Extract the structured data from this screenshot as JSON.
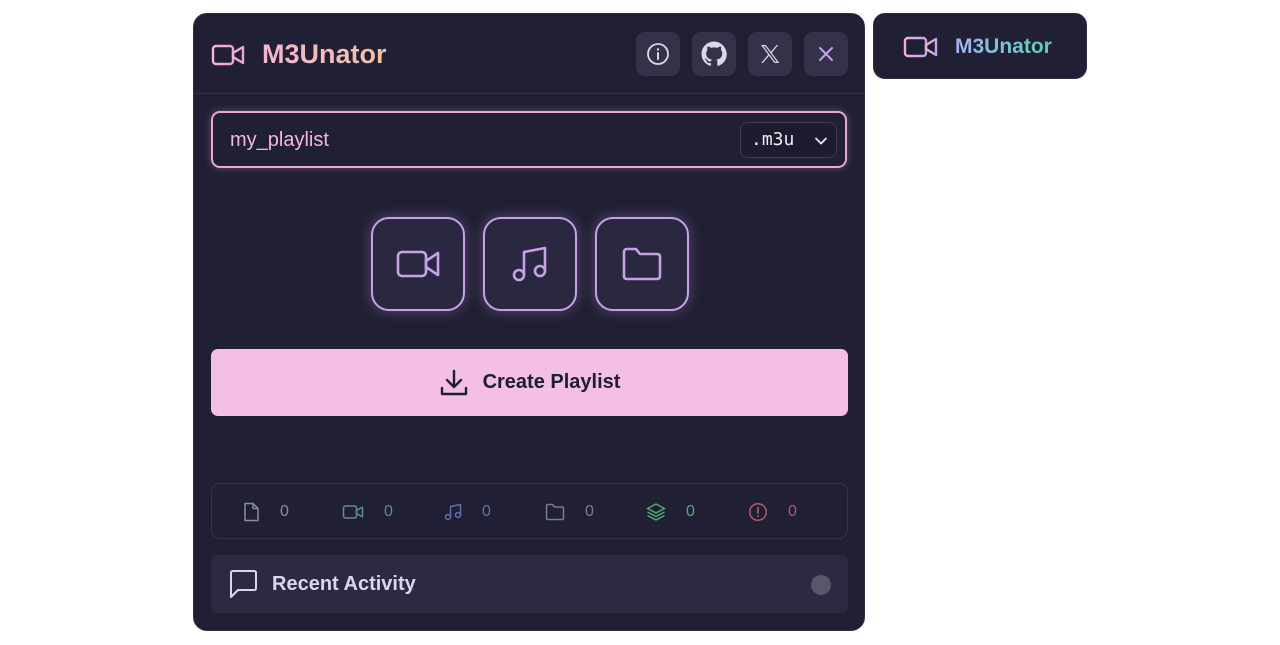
{
  "app": {
    "title": "M3Unator",
    "logo_icon": "video-camera-icon"
  },
  "header": {
    "buttons": [
      {
        "name": "info-button",
        "icon": "info-icon"
      },
      {
        "name": "github-button",
        "icon": "github-icon"
      },
      {
        "name": "x-twitter-button",
        "icon": "x-logo-icon"
      },
      {
        "name": "close-button",
        "icon": "close-icon"
      }
    ]
  },
  "playlist": {
    "name_value": "my_playlist",
    "extension": ".m3u"
  },
  "type_buttons": [
    {
      "name": "video-type-button",
      "icon": "video-camera-icon"
    },
    {
      "name": "audio-type-button",
      "icon": "music-note-icon"
    },
    {
      "name": "folder-type-button",
      "icon": "folder-icon"
    }
  ],
  "create_button": {
    "label": "Create Playlist",
    "icon": "download-icon"
  },
  "stats": [
    {
      "icon": "file-icon",
      "value": "0",
      "color": "#8a8aa6"
    },
    {
      "icon": "video-icon",
      "value": "0",
      "color": "#5c8f86"
    },
    {
      "icon": "music-icon",
      "value": "0",
      "color": "#5f73a8"
    },
    {
      "icon": "folder-icon",
      "value": "0",
      "color": "#7b7b94"
    },
    {
      "icon": "layers-icon",
      "value": "0",
      "color": "#55a872"
    },
    {
      "icon": "alert-icon",
      "value": "0",
      "color": "#b15a72"
    }
  ],
  "recent_activity": {
    "label": "Recent Activity",
    "icon": "chat-icon"
  },
  "mini_widget": {
    "title": "M3Unator",
    "icon": "video-camera-icon"
  },
  "colors": {
    "accent_pink": "#f3bfe4",
    "accent_purple": "#c7a0e8",
    "panel_bg": "#201f33"
  }
}
